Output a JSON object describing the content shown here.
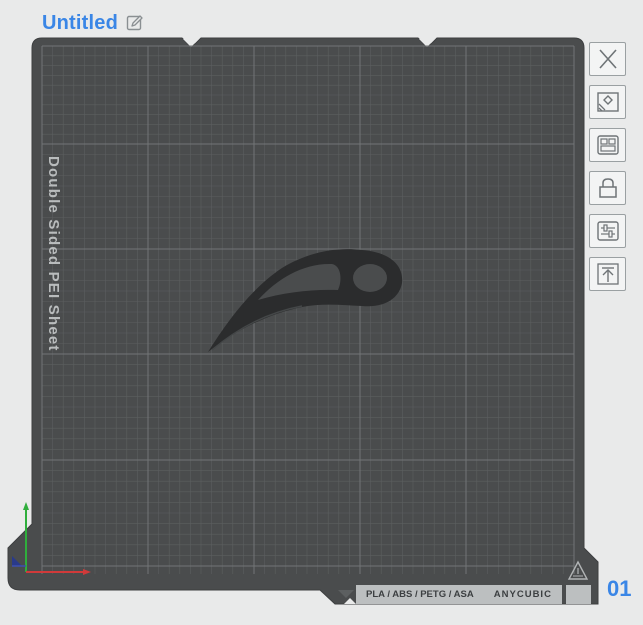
{
  "header": {
    "title": "Untitled",
    "edit_icon": "edit-pencil-icon"
  },
  "bed": {
    "sheet_label": "Double Sided PEI Sheet",
    "material_label": "PLA / ABS / PETG / ASA",
    "brand_label": "ANYCUBIC",
    "plate_number": "01",
    "model_name": "blade-model",
    "colors": {
      "bed": "#4a4c4d",
      "grid": "#5c5f60",
      "grid_major": "#727577",
      "model": "#2b2c2d",
      "axis_x": "#d03a3a",
      "axis_y": "#2fae3c",
      "accent": "#3a86e6"
    }
  },
  "toolbar": {
    "buttons": [
      {
        "id": "close",
        "icon": "close-icon"
      },
      {
        "id": "auto-arrange",
        "icon": "auto-arrange-icon"
      },
      {
        "id": "plate-settings",
        "icon": "plate-settings-icon"
      },
      {
        "id": "lock",
        "icon": "lock-icon"
      },
      {
        "id": "adjust",
        "icon": "sliders-icon"
      },
      {
        "id": "export",
        "icon": "export-icon"
      }
    ]
  }
}
